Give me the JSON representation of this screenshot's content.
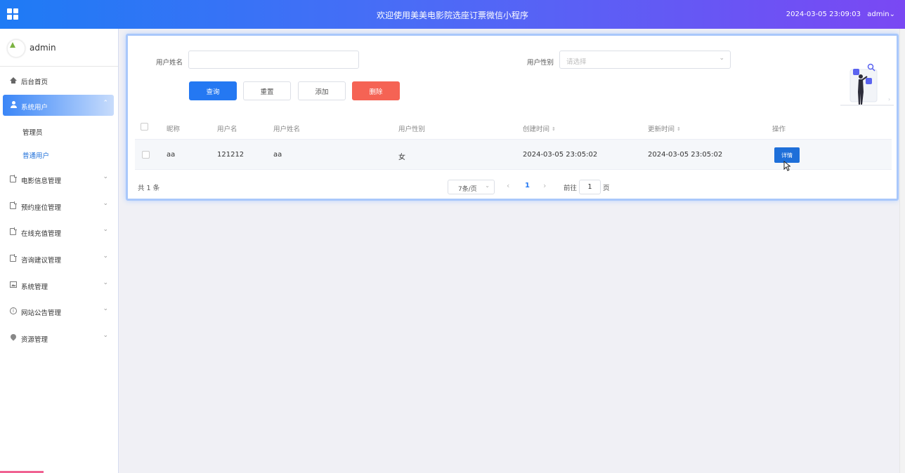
{
  "header": {
    "title": "欢迎使用美美电影院选座订票微信小程序",
    "datetime": "2024-03-05 23:09:03",
    "user": "admin",
    "user_caret": "⌄"
  },
  "sidebar": {
    "username": "admin",
    "home": "后台首页",
    "system_users": "系统用户",
    "sub_admin": "管理员",
    "sub_normal": "普通用户",
    "movie": "电影信息管理",
    "seat": "预约座位管理",
    "recharge": "在线充值管理",
    "advice": "咨询建议管理",
    "system": "系统管理",
    "notice": "网站公告管理",
    "resource": "资源管理",
    "arrow_down": "⌄",
    "arrow_up": "⌃"
  },
  "search": {
    "name_label": "用户姓名",
    "name_value": "",
    "gender_label": "用户性别",
    "gender_placeholder": "请选择",
    "caret": "⌄",
    "query": "查询",
    "reset": "重置",
    "add": "添加",
    "delete": "删除"
  },
  "table": {
    "columns": [
      "昵称",
      "用户名",
      "用户姓名",
      "用户性别",
      "创建时间",
      "更新时间",
      "操作"
    ],
    "sort_glyph": "⇕",
    "rows": [
      {
        "nickname": "aa",
        "username": "121212",
        "realname": "aa",
        "gender": "女",
        "created": "2024-03-05 23:05:02",
        "updated": "2024-03-05 23:05:02",
        "action": "详情"
      }
    ]
  },
  "pagination": {
    "total": "共 1 条",
    "page_size": "7条/页",
    "caret": "⌄",
    "prev": "‹",
    "next": "›",
    "current": "1",
    "goto_label": "前往",
    "goto_value": "1",
    "goto_suffix": "页"
  }
}
